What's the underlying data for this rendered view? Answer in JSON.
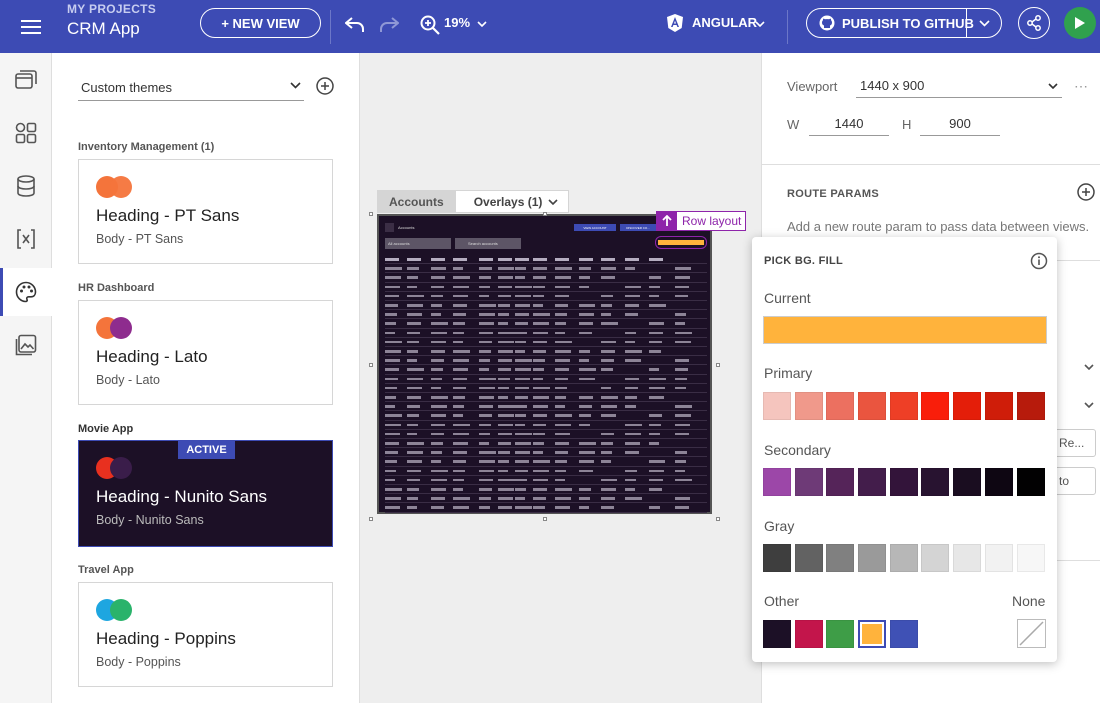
{
  "header": {
    "project_label": "MY PROJECTS",
    "app_name": "CRM App",
    "new_view_label": "+ NEW VIEW",
    "zoom_label": "19%",
    "framework_label": "ANGULAR",
    "publish_label": "PUBLISH TO GITHUB"
  },
  "themes": {
    "selector_value": "Custom themes",
    "groups": [
      {
        "label": "Inventory Management (1)",
        "heading": "Heading - PT Sans",
        "body": "Body - PT Sans",
        "dot1": "#f4743b",
        "dot2": "#f4743b"
      },
      {
        "label": "HR Dashboard",
        "heading": "Heading - Lato",
        "body": "Body - Lato",
        "dot1": "#f4743b",
        "dot2": "#8e2c8e"
      },
      {
        "label": "Movie App",
        "heading": "Heading - Nunito Sans",
        "body": "Body - Nunito Sans",
        "dot1": "#e8301f",
        "dot2": "#3a1d4a",
        "badge": "ACTIVE"
      },
      {
        "label": "Travel App",
        "heading": "Heading - Poppins",
        "body": "Body - Poppins",
        "dot1": "#1ea6e0",
        "dot2": "#2ab36b"
      }
    ]
  },
  "canvas": {
    "crumb_accounts": "Accounts",
    "crumb_overlays": "Overlays (1)",
    "row_layout_label": "Row layout",
    "mini_title": "Accounts",
    "mini_select": "All accounts",
    "mini_search": "Search accounts",
    "mini_btn1": "VIEW ACCOUNT",
    "mini_btn2": "DISCOVER CO..."
  },
  "properties": {
    "viewport_label": "Viewport",
    "viewport_value": "1440 x 900",
    "w_label": "W",
    "w_value": "1440",
    "h_label": "H",
    "h_value": "900",
    "route_params_title": "ROUTE PARAMS",
    "route_params_hint": "Add a new route param to pass data between views.",
    "faded_btn1": "Re...",
    "faded_btn2": "to"
  },
  "color_picker": {
    "title": "PICK BG. FILL",
    "current_label": "Current",
    "current_color": "#ffb33c",
    "primary_label": "Primary",
    "primary": [
      "#f5c5be",
      "#f0998b",
      "#ec7060",
      "#ea553f",
      "#ee3f26",
      "#f91e0a",
      "#e41e09",
      "#cf1d09",
      "#b71b0c"
    ],
    "secondary_label": "Secondary",
    "secondary": [
      "#9c47a8",
      "#6e3a77",
      "#552459",
      "#431d4b",
      "#33143a",
      "#281330",
      "#1a0d20",
      "#0e0612",
      "#020102"
    ],
    "gray_label": "Gray",
    "gray": [
      "#3e3e3e",
      "#626262",
      "#808080",
      "#9a9a9a",
      "#b7b7b7",
      "#d4d4d4",
      "#e7e7e7",
      "#f2f2f2",
      "#f7f7f7"
    ],
    "other_label": "Other",
    "other": [
      "#1c1026",
      "#c3154b",
      "#3e9d47",
      "#ffb33c",
      "#3f51b5"
    ],
    "none_label": "None"
  }
}
